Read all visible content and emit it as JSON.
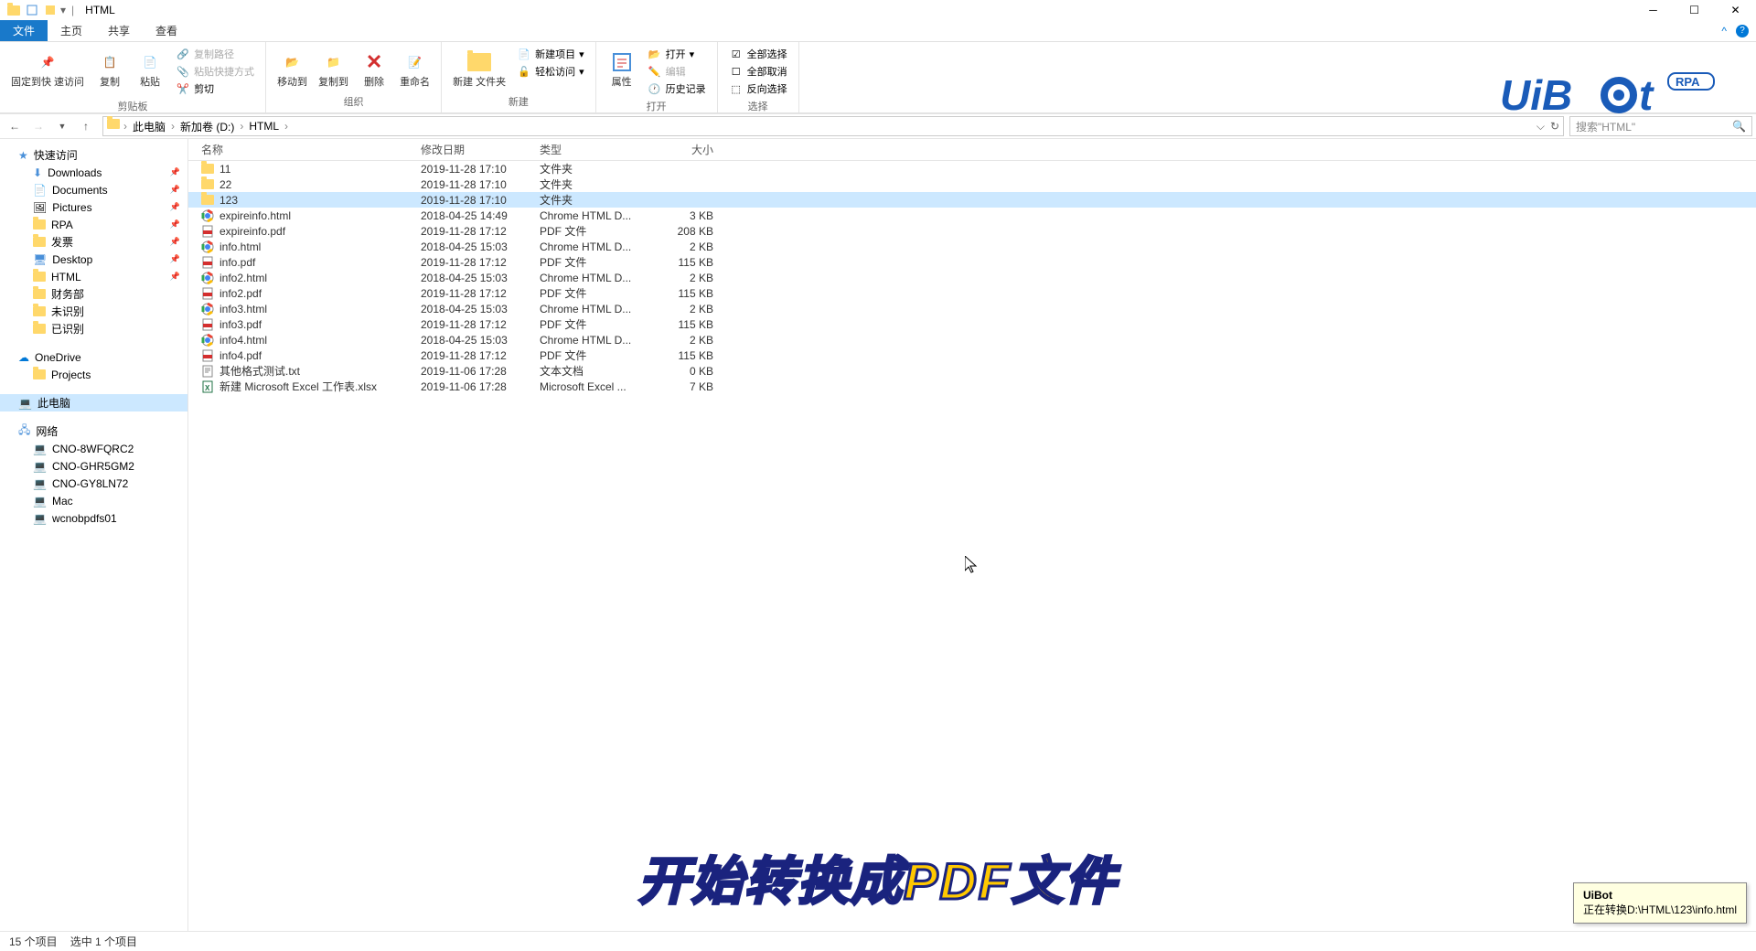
{
  "window": {
    "title": "HTML"
  },
  "menu": {
    "tabs": [
      "文件",
      "主页",
      "共享",
      "查看"
    ],
    "active": 0
  },
  "ribbon": {
    "groups": [
      {
        "label": "剪贴板",
        "big": [
          "固定到快\n速访问",
          "复制",
          "粘贴"
        ],
        "small": [
          "复制路径",
          "粘贴快捷方式",
          "剪切"
        ]
      },
      {
        "label": "组织",
        "big": [
          "移动到",
          "复制到",
          "删除",
          "重命名"
        ]
      },
      {
        "label": "新建",
        "big": [
          "新建\n文件夹"
        ],
        "small": [
          "新建项目",
          "轻松访问"
        ]
      },
      {
        "label": "打开",
        "big": [
          "属性"
        ],
        "small": [
          "打开",
          "编辑",
          "历史记录"
        ]
      },
      {
        "label": "选择",
        "small": [
          "全部选择",
          "全部取消",
          "反向选择"
        ]
      }
    ]
  },
  "breadcrumb": {
    "items": [
      "此电脑",
      "新加卷 (D:)",
      "HTML"
    ]
  },
  "search": {
    "placeholder": "搜索\"HTML\""
  },
  "sidebar": {
    "quick": {
      "label": "快速访问",
      "items": [
        "Downloads",
        "Documents",
        "Pictures",
        "RPA",
        "发票",
        "Desktop",
        "HTML",
        "财务部",
        "未识别",
        "已识别"
      ]
    },
    "onedrive": {
      "label": "OneDrive",
      "items": [
        "Projects"
      ]
    },
    "thispc": {
      "label": "此电脑"
    },
    "network": {
      "label": "网络",
      "items": [
        "CNO-8WFQRC2",
        "CNO-GHR5GM2",
        "CNO-GY8LN72",
        "Mac",
        "wcnobpdfs01"
      ]
    }
  },
  "filelist": {
    "headers": {
      "name": "名称",
      "date": "修改日期",
      "type": "类型",
      "size": "大小"
    },
    "rows": [
      {
        "icon": "folder",
        "name": "11",
        "date": "2019-11-28 17:10",
        "type": "文件夹",
        "size": ""
      },
      {
        "icon": "folder",
        "name": "22",
        "date": "2019-11-28 17:10",
        "type": "文件夹",
        "size": ""
      },
      {
        "icon": "folder",
        "name": "123",
        "date": "2019-11-28 17:10",
        "type": "文件夹",
        "size": "",
        "selected": true
      },
      {
        "icon": "chrome",
        "name": "expireinfo.html",
        "date": "2018-04-25 14:49",
        "type": "Chrome HTML D...",
        "size": "3 KB"
      },
      {
        "icon": "pdf",
        "name": "expireinfo.pdf",
        "date": "2019-11-28 17:12",
        "type": "PDF 文件",
        "size": "208 KB"
      },
      {
        "icon": "chrome",
        "name": "info.html",
        "date": "2018-04-25 15:03",
        "type": "Chrome HTML D...",
        "size": "2 KB"
      },
      {
        "icon": "pdf",
        "name": "info.pdf",
        "date": "2019-11-28 17:12",
        "type": "PDF 文件",
        "size": "115 KB"
      },
      {
        "icon": "chrome",
        "name": "info2.html",
        "date": "2018-04-25 15:03",
        "type": "Chrome HTML D...",
        "size": "2 KB"
      },
      {
        "icon": "pdf",
        "name": "info2.pdf",
        "date": "2019-11-28 17:12",
        "type": "PDF 文件",
        "size": "115 KB"
      },
      {
        "icon": "chrome",
        "name": "info3.html",
        "date": "2018-04-25 15:03",
        "type": "Chrome HTML D...",
        "size": "2 KB"
      },
      {
        "icon": "pdf",
        "name": "info3.pdf",
        "date": "2019-11-28 17:12",
        "type": "PDF 文件",
        "size": "115 KB"
      },
      {
        "icon": "chrome",
        "name": "info4.html",
        "date": "2018-04-25 15:03",
        "type": "Chrome HTML D...",
        "size": "2 KB"
      },
      {
        "icon": "pdf",
        "name": "info4.pdf",
        "date": "2019-11-28 17:12",
        "type": "PDF 文件",
        "size": "115 KB"
      },
      {
        "icon": "txt",
        "name": "其他格式测试.txt",
        "date": "2019-11-06 17:28",
        "type": "文本文档",
        "size": "0 KB"
      },
      {
        "icon": "xlsx",
        "name": "新建 Microsoft Excel 工作表.xlsx",
        "date": "2019-11-06 17:28",
        "type": "Microsoft Excel ...",
        "size": "7 KB"
      }
    ]
  },
  "status": {
    "count": "15 个项目",
    "selected": "选中 1 个项目"
  },
  "overlay": {
    "text": "开始转换成PDF文件"
  },
  "notification": {
    "title": "UiBot",
    "body": "正在转换D:\\HTML\\123\\info.html"
  },
  "logo": {
    "brand": "UiBot",
    "badge": "RPA"
  }
}
